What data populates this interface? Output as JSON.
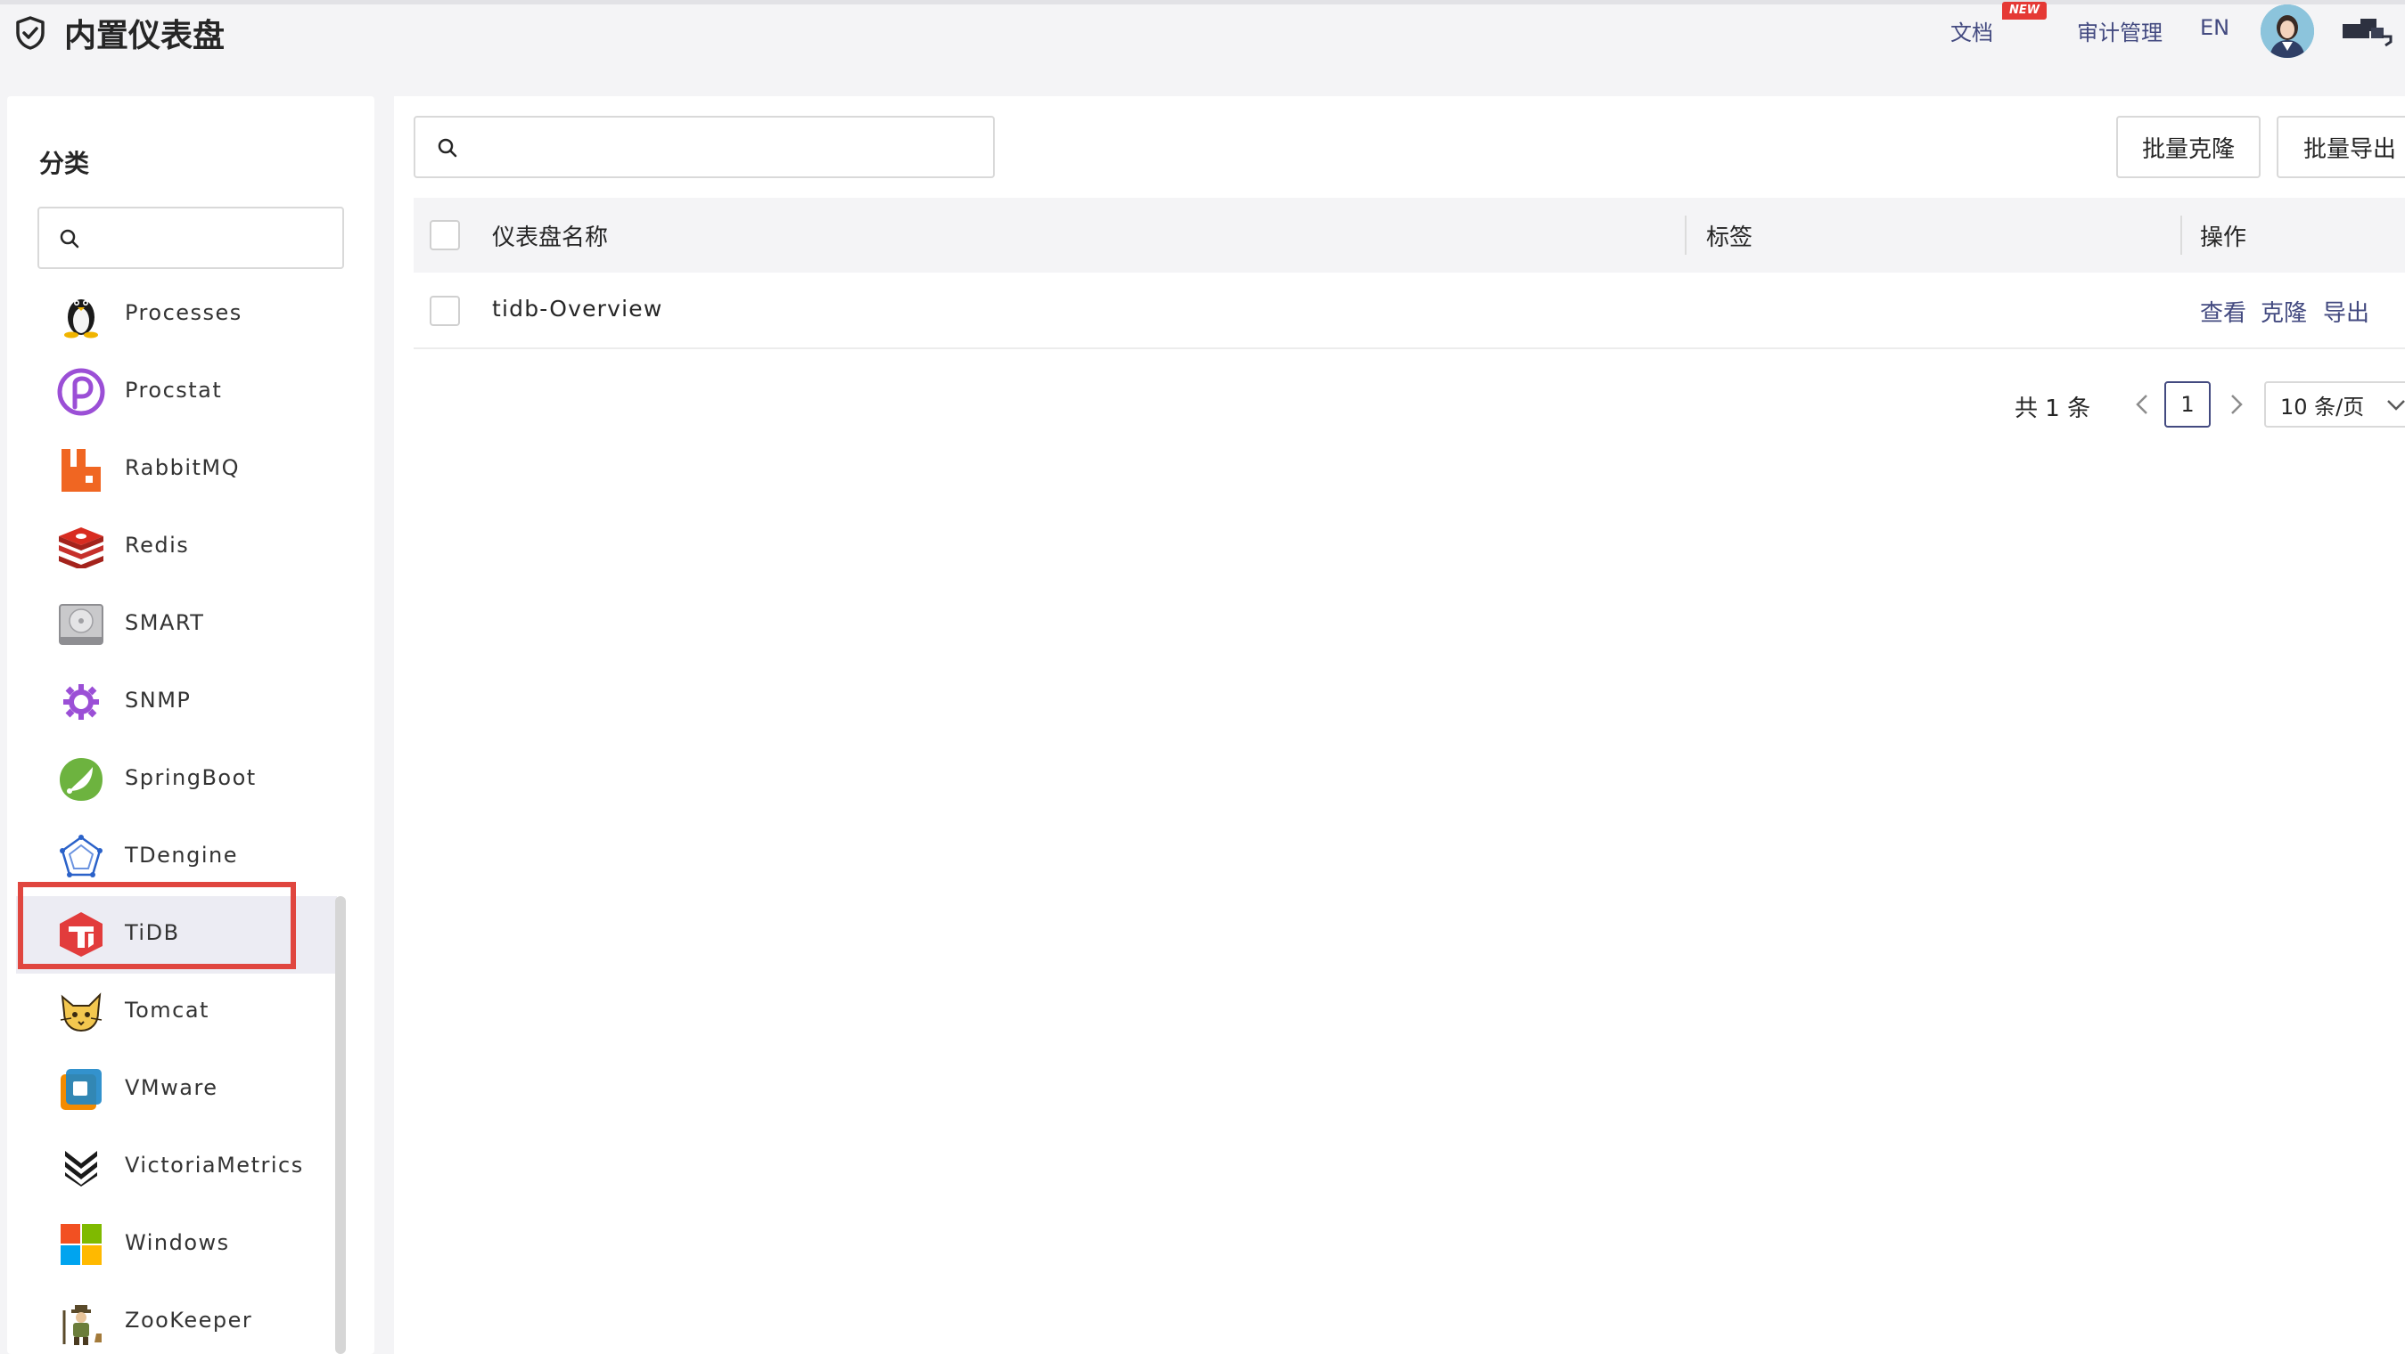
{
  "header": {
    "title": "内置仪表盘",
    "docs": "文档",
    "new_badge": "NEW",
    "audit": "审计管理",
    "lang": "EN"
  },
  "sidebar": {
    "title": "分类",
    "search_placeholder": "",
    "items": [
      {
        "label": "Processes",
        "icon": "linux-penguin-icon"
      },
      {
        "label": "Procstat",
        "icon": "procstat-icon"
      },
      {
        "label": "RabbitMQ",
        "icon": "rabbitmq-icon"
      },
      {
        "label": "Redis",
        "icon": "redis-icon"
      },
      {
        "label": "SMART",
        "icon": "hard-disk-icon"
      },
      {
        "label": "SNMP",
        "icon": "snmp-icon"
      },
      {
        "label": "SpringBoot",
        "icon": "springboot-icon"
      },
      {
        "label": "TDengine",
        "icon": "tdengine-icon"
      },
      {
        "label": "TiDB",
        "icon": "tidb-icon"
      },
      {
        "label": "Tomcat",
        "icon": "tomcat-icon"
      },
      {
        "label": "VMware",
        "icon": "vmware-icon"
      },
      {
        "label": "VictoriaMetrics",
        "icon": "victoriametrics-icon"
      },
      {
        "label": "Windows",
        "icon": "windows-icon"
      },
      {
        "label": "ZooKeeper",
        "icon": "zookeeper-icon"
      }
    ],
    "active_item": "TiDB"
  },
  "main": {
    "search_placeholder": "",
    "buttons": {
      "clone": "批量克隆",
      "export": "批量导出"
    },
    "columns": {
      "name": "仪表盘名称",
      "tags": "标签",
      "ops": "操作"
    },
    "rows": [
      {
        "name": "tidb-Overview",
        "tags": "",
        "ops": {
          "view": "查看",
          "clone": "克隆",
          "export": "导出"
        }
      }
    ],
    "pagination": {
      "total": "共 1 条",
      "current_page": "1",
      "page_size": "10 条/页"
    }
  },
  "colors": {
    "accent": "#434a80",
    "highlight": "#e0463f",
    "badge": "#e53935"
  }
}
